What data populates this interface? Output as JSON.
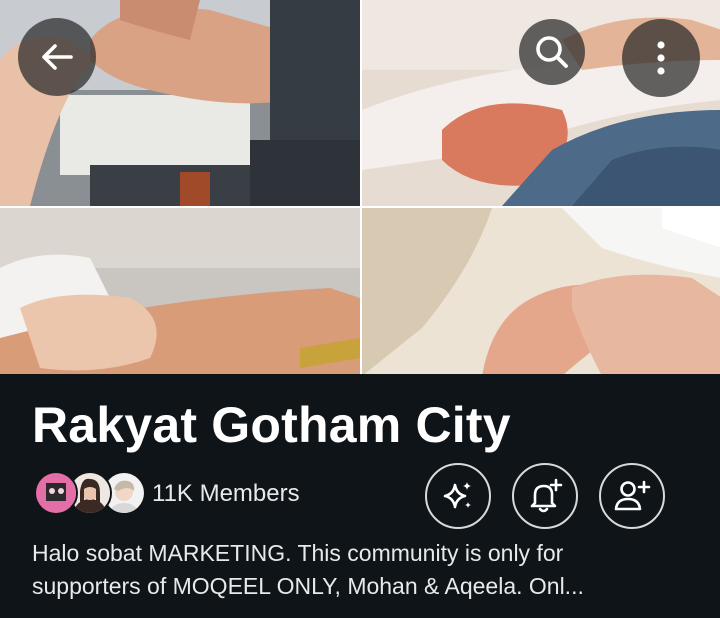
{
  "community": {
    "title": "Rakyat Gotham City",
    "members_label": "11K Members",
    "description_line1": "Halo sobat MARKETING. This community is only for",
    "description_line2": "supporters of MOQEEL ONLY, Mohan & Aqeela. Onl..."
  },
  "icons": {
    "back": "arrow-left-icon",
    "search": "search-icon",
    "more": "vertical-dots-icon",
    "sparkle": "sparkle-icon",
    "notify": "bell-plus-icon",
    "join": "person-plus-icon"
  },
  "colors": {
    "background": "#0f1418",
    "text": "#e7e9ea",
    "title": "#ffffff",
    "button_border": "#d9d9d9"
  }
}
